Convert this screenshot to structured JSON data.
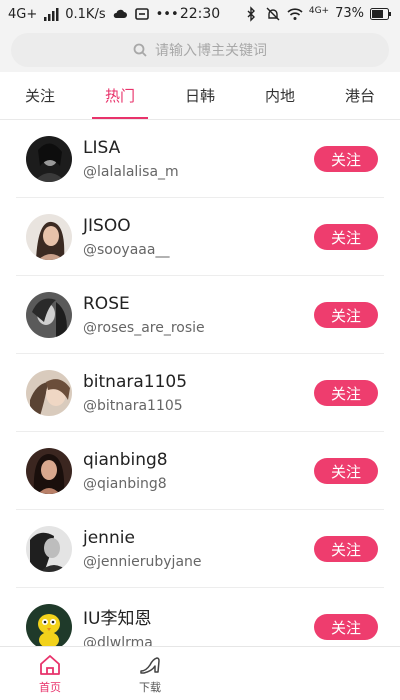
{
  "status_bar": {
    "network": "4G+",
    "speed": "0.1K/s",
    "dots": "•••",
    "time": "22:30",
    "network_right": "4G+",
    "battery": "73%"
  },
  "search": {
    "placeholder": "请输入博主关键词"
  },
  "tabs": [
    {
      "label": "关注"
    },
    {
      "label": "热门"
    },
    {
      "label": "日韩"
    },
    {
      "label": "内地"
    },
    {
      "label": "港台"
    }
  ],
  "active_tab": "热门",
  "follow_label": "关注",
  "bloggers": [
    {
      "name": "LISA",
      "handle": "@lalalalisa_m"
    },
    {
      "name": "JISOO",
      "handle": "@sooyaaa__"
    },
    {
      "name": "ROSE",
      "handle": "@roses_are_rosie"
    },
    {
      "name": "bitnara1105",
      "handle": "@bitnara1105"
    },
    {
      "name": "qianbing8",
      "handle": "@qianbing8"
    },
    {
      "name": "jennie",
      "handle": "@jennierubyjane"
    },
    {
      "name": "IU李知恩",
      "handle": "@dlwlrma"
    }
  ],
  "bottom_nav": {
    "home_label": "首页",
    "download_label": "下载"
  },
  "colors": {
    "accent": "#ee3d6e",
    "status_bar_bg": "#f3f3f3",
    "search_bg": "#ececec"
  }
}
